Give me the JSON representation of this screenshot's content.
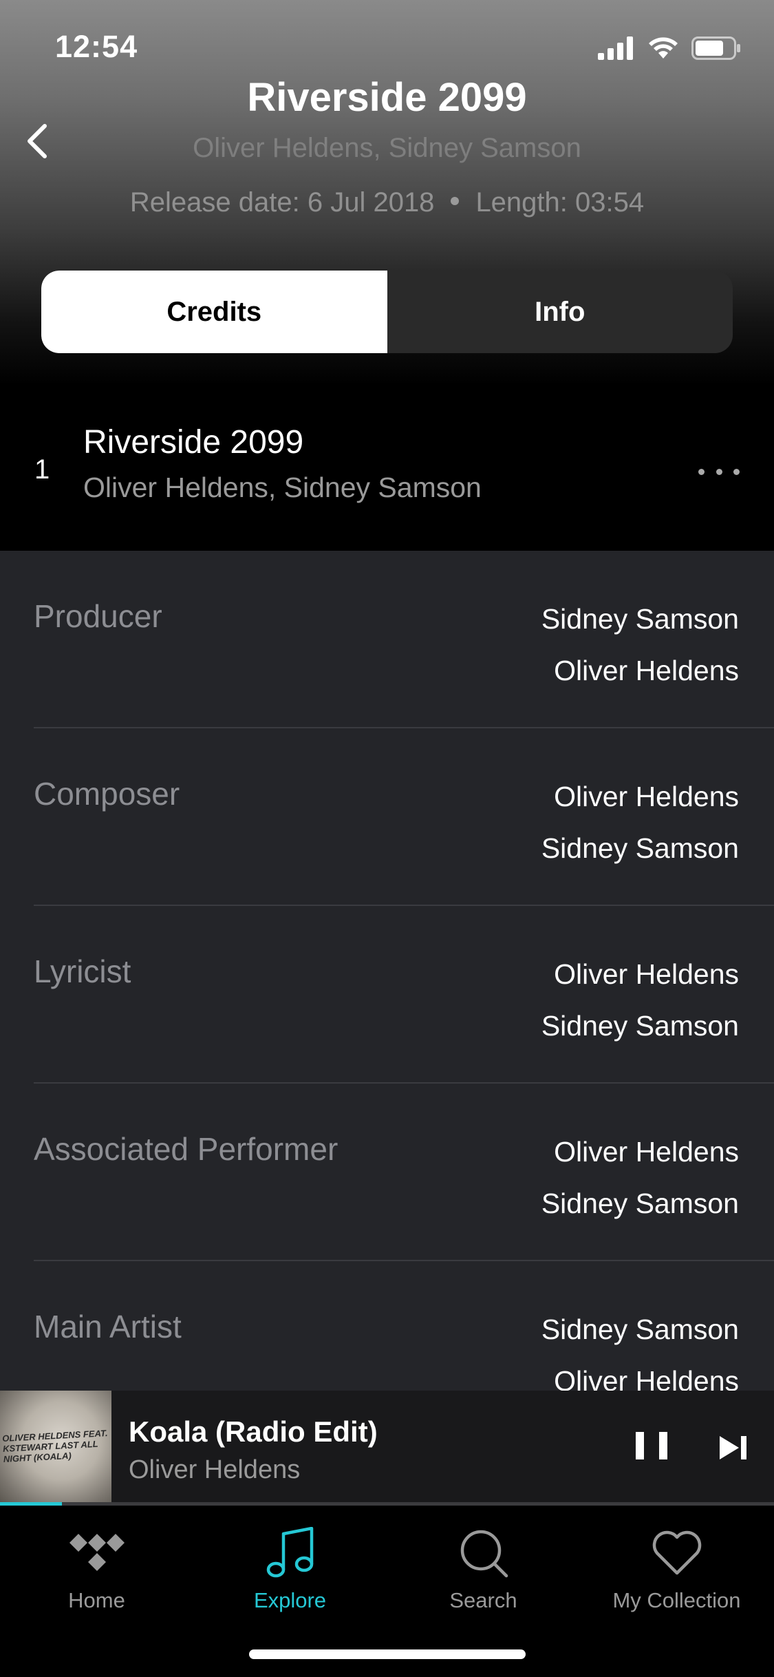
{
  "status": {
    "time": "12:54",
    "icons": [
      "signal-icon",
      "wifi-icon",
      "battery-icon"
    ]
  },
  "header": {
    "back_icon": "chevron-left-icon",
    "title": "Riverside 2099",
    "artists": "Oliver Heldens, Sidney Samson",
    "release_date": "Release date: 6 Jul 2018",
    "length": "Length: 03:54"
  },
  "tabs": {
    "credits": "Credits",
    "info": "Info",
    "selected": "Credits"
  },
  "track": {
    "number": "1",
    "title": "Riverside 2099",
    "artists": "Oliver Heldens, Sidney Samson",
    "more_icon": "more-horizontal-icon"
  },
  "credits": [
    {
      "role": "Producer",
      "names": [
        "Sidney Samson",
        "Oliver Heldens"
      ]
    },
    {
      "role": "Composer",
      "names": [
        "Oliver Heldens",
        "Sidney Samson"
      ]
    },
    {
      "role": "Lyricist",
      "names": [
        "Oliver Heldens",
        "Sidney Samson"
      ]
    },
    {
      "role": "Associated Performer",
      "names": [
        "Oliver Heldens",
        "Sidney Samson"
      ]
    },
    {
      "role": "Main Artist",
      "names": [
        "Sidney Samson",
        "Oliver Heldens"
      ]
    }
  ],
  "now_playing": {
    "album_art_text": "OLIVER HELDENS FEAT. KSTEWART LAST ALL NIGHT (KOALA)",
    "title": "Koala (Radio Edit)",
    "artist": "Oliver Heldens",
    "progress_fraction": 0.08,
    "pause_icon": "pause-icon",
    "next_icon": "skip-next-icon"
  },
  "tabbar": [
    {
      "label": "Home",
      "icon": "tidal-logo-icon",
      "active": false
    },
    {
      "label": "Explore",
      "icon": "music-note-icon",
      "active": true
    },
    {
      "label": "Search",
      "icon": "search-icon",
      "active": false
    },
    {
      "label": "My Collection",
      "icon": "heart-icon",
      "active": false
    }
  ],
  "colors": {
    "accent": "#25c8d5",
    "list_background": "#242529",
    "secondary_text": "#9a9a9a"
  }
}
